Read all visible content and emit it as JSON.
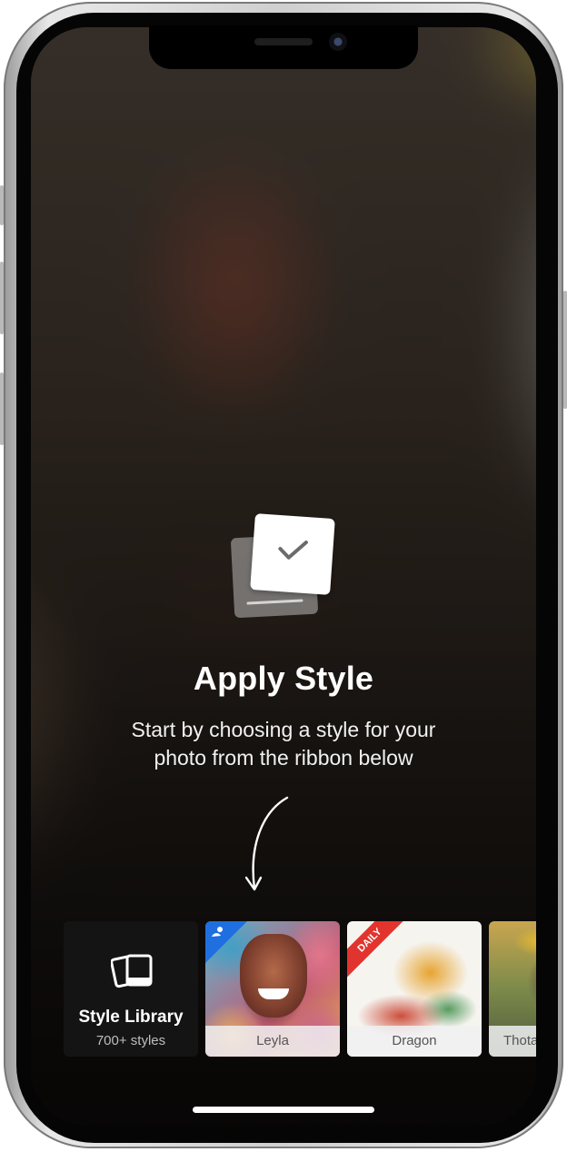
{
  "onboarding": {
    "title": "Apply Style",
    "subtitle_line1": "Start by choosing a style for your",
    "subtitle_line2": "photo from the ribbon below"
  },
  "ribbon": {
    "library": {
      "title": "Style Library",
      "subtitle": "700+ styles",
      "icon": "photos-stack-icon"
    },
    "styles": [
      {
        "label": "Leyla",
        "badge_icon": "person-badge-icon",
        "badge_color": "#1f6fe0"
      },
      {
        "label": "Dragon",
        "badge_text": "DAILY",
        "badge_color": "#e2342e"
      },
      {
        "label": "Thota"
      }
    ]
  },
  "colors": {
    "accent_blue": "#1f6fe0",
    "daily_red": "#e2342e",
    "text_white": "#ffffff"
  }
}
